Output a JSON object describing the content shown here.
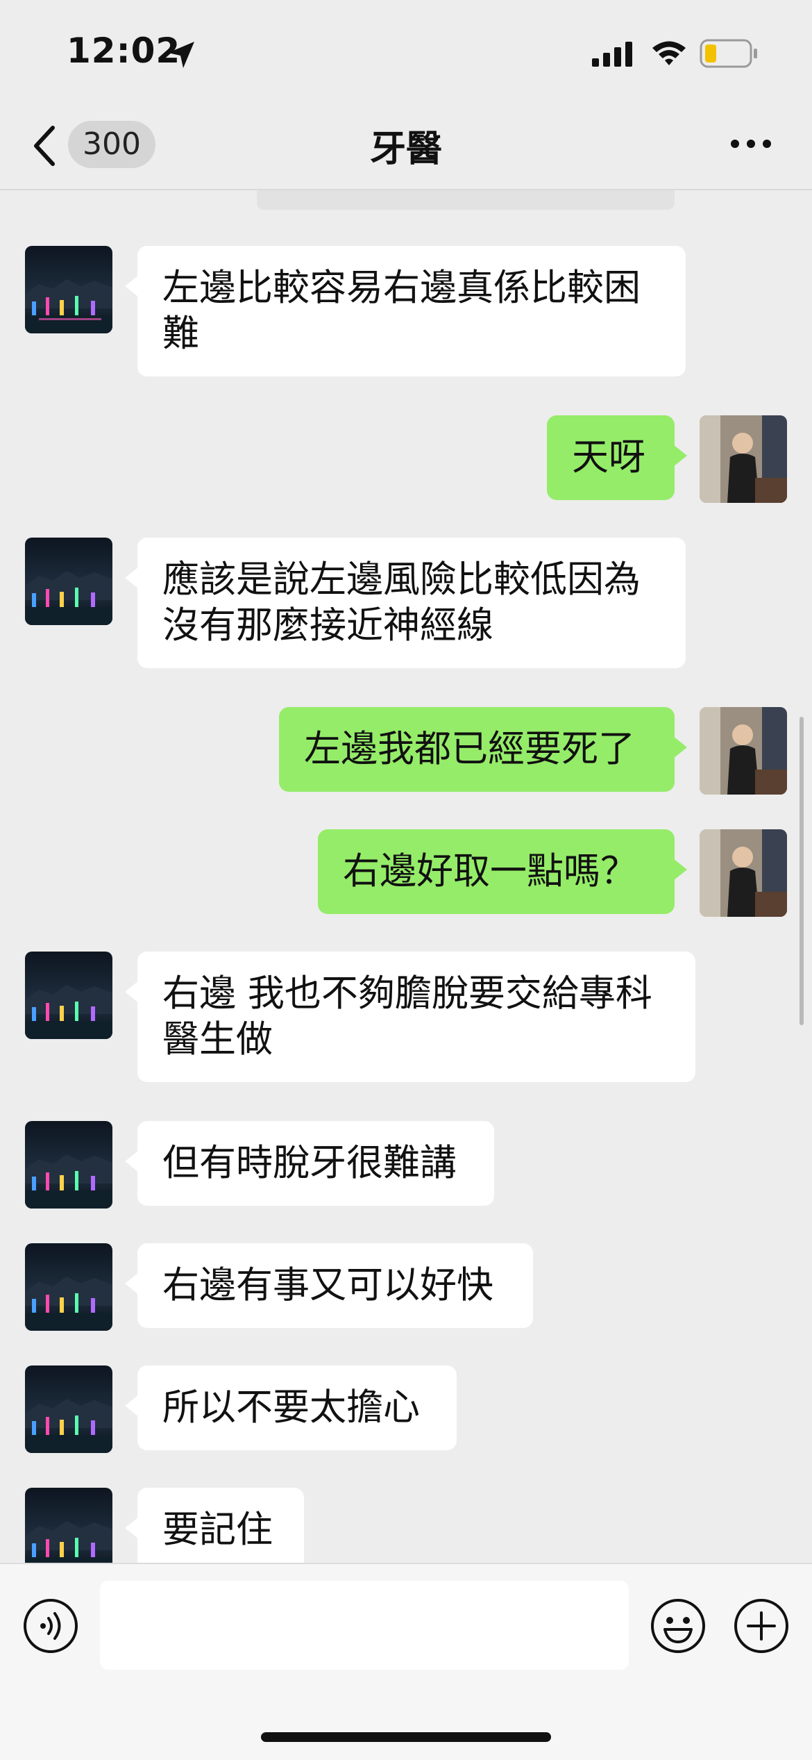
{
  "status": {
    "time": "12:02"
  },
  "nav": {
    "unread_count": "300",
    "title": "牙醫"
  },
  "messages": [
    {
      "side": "in",
      "text": "左邊比較容易右邊真係比較困難"
    },
    {
      "side": "out",
      "text": "天呀"
    },
    {
      "side": "in",
      "text": "應該是說左邊風險比較低因為沒有那麼接近神經線"
    },
    {
      "side": "out",
      "text": "左邊我都已經要死了"
    },
    {
      "side": "out",
      "text": "右邊好取一點嗎？"
    },
    {
      "side": "in",
      "text": "右邊 我也不夠膽脫要交給專科醫生做"
    },
    {
      "side": "in",
      "text": "但有時脫牙很難講"
    },
    {
      "side": "in",
      "text": "右邊有事又可以好快"
    },
    {
      "side": "in",
      "text": "所以不要太擔心"
    },
    {
      "side": "in",
      "text": "要記住"
    }
  ],
  "input": {
    "value": ""
  },
  "icons": {
    "back": "chevron-left-icon",
    "more": "more-dots-icon",
    "voice": "voice-icon",
    "emoji": "emoji-icon",
    "plus": "plus-icon"
  },
  "colors": {
    "outgoing_bubble": "#95ec69",
    "incoming_bubble": "#ffffff",
    "background": "#ededed"
  }
}
